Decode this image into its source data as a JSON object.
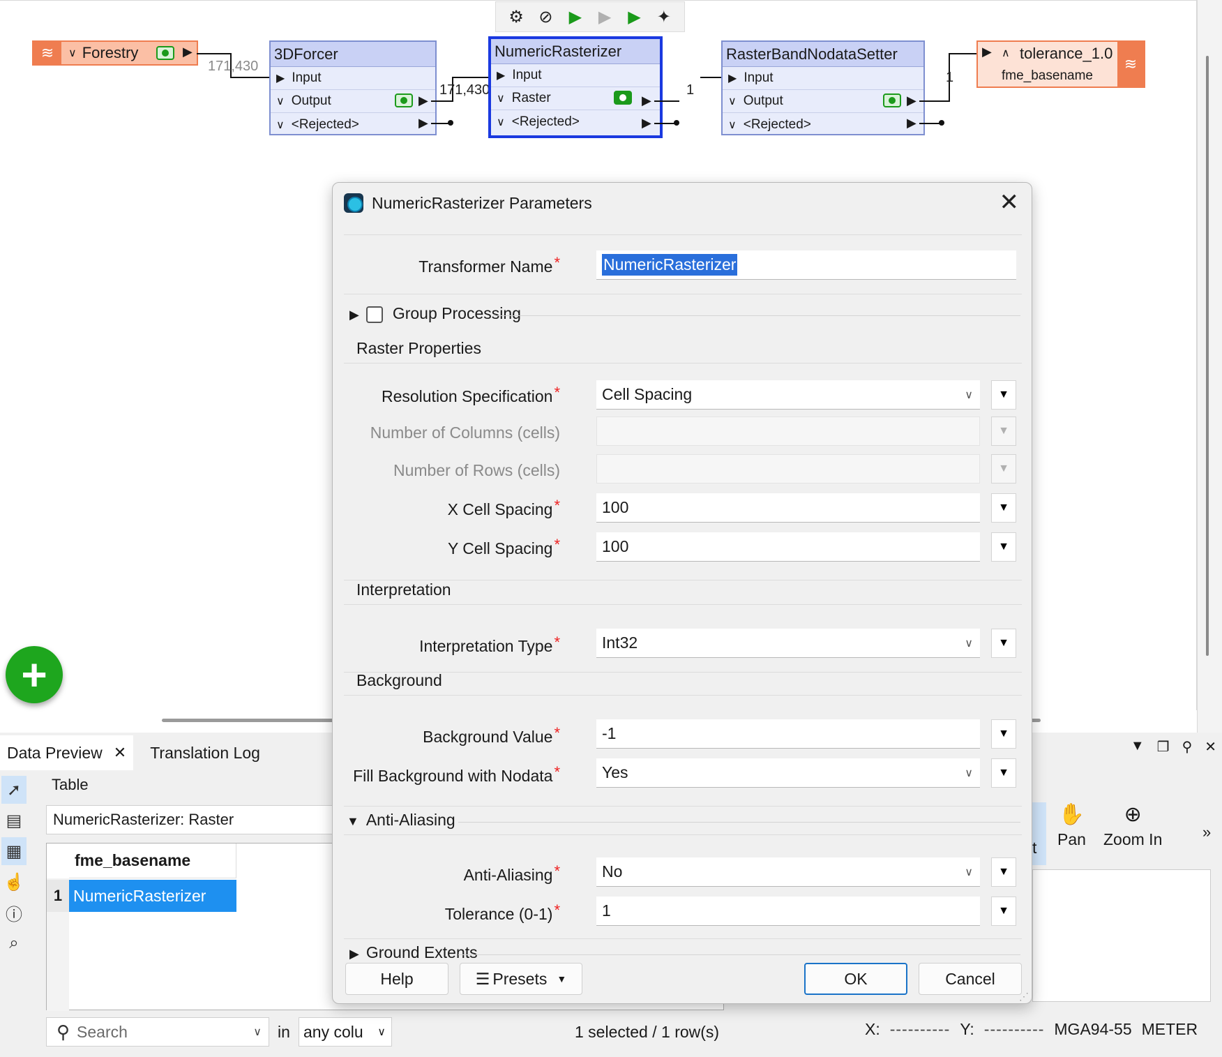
{
  "toolbar": {
    "icons": [
      "gear-icon",
      "disable-icon",
      "run-icon",
      "run-to-icon",
      "run-from-icon",
      "sparkle-icon"
    ]
  },
  "canvas": {
    "reader": {
      "name": "Forestry",
      "count": "171,430"
    },
    "forcer": {
      "name": "3DForcer",
      "input": "Input",
      "output": "Output",
      "rejected": "<Rejected>",
      "count": "171,430"
    },
    "rasterizer": {
      "name": "NumericRasterizer",
      "input": "Input",
      "output": "Raster",
      "rejected": "<Rejected>",
      "count": "1"
    },
    "nodata": {
      "name": "RasterBandNodataSetter",
      "input": "Input",
      "output": "Output",
      "rejected": "<Rejected>",
      "count": "1"
    },
    "writer": {
      "name": "tolerance_1.0",
      "attr": "fme_basename"
    }
  },
  "bottom": {
    "tabs": [
      "Data Preview",
      "Translation Log"
    ],
    "table_label": "Table",
    "table_select": "NumericRasterizer: Raster",
    "column_header": "fme_basename",
    "row_number": "1",
    "row_value": "NumericRasterizer",
    "search_placeholder": "Search",
    "in_label": "in",
    "column_filter": "any colu",
    "row_count": "1 selected / 1 row(s)",
    "tools": [
      "Pan",
      "Zoom In"
    ],
    "partial_tool": "t",
    "more": "»",
    "x_label": "X:",
    "y_label": "Y:",
    "x_value": "----------",
    "y_value": "----------",
    "crs": "MGA94-55",
    "units": "METER"
  },
  "dialog": {
    "title": "NumericRasterizer Parameters",
    "transformer_name_label": "Transformer Name",
    "transformer_name_value": "NumericRasterizer",
    "group_processing": "Group Processing",
    "raster_properties": "Raster Properties",
    "resolution_label": "Resolution Specification",
    "resolution_value": "Cell Spacing",
    "columns_label": "Number of Columns (cells)",
    "rows_label": "Number of Rows (cells)",
    "x_spacing_label": "X Cell Spacing",
    "x_spacing_value": "100",
    "y_spacing_label": "Y Cell Spacing",
    "y_spacing_value": "100",
    "interpretation": "Interpretation",
    "interp_type_label": "Interpretation Type",
    "interp_type_value": "Int32",
    "background": "Background",
    "bg_value_label": "Background Value",
    "bg_value": "-1",
    "fill_label": "Fill Background with Nodata",
    "fill_value": "Yes",
    "anti_aliasing": "Anti-Aliasing",
    "aa_label": "Anti-Aliasing",
    "aa_value": "No",
    "tolerance_label": "Tolerance (0-1)",
    "tolerance_value": "1",
    "ground_extents": "Ground Extents",
    "help": "Help",
    "presets": "Presets",
    "ok": "OK",
    "cancel": "Cancel"
  }
}
